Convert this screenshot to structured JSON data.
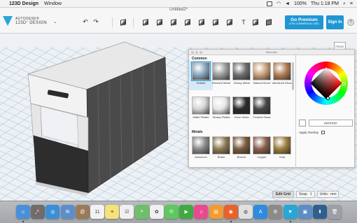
{
  "menubar": {
    "apple": "",
    "app_name": "123D Design",
    "menu_window": "Window",
    "battery": "100%",
    "clock": "Thu 1:18 PM"
  },
  "toolbar": {
    "doc_title": "Untitled2*",
    "logo_line1": "AUTODESK®",
    "logo_line2": "123D° DESIGN",
    "premium_title": "Go Premium",
    "premium_sub": "(FOR COMMERCIAL USE)",
    "sign_in": "Sign In",
    "help": "?",
    "text_tool": "T"
  },
  "viewcube": {
    "face": "FRONT"
  },
  "materials": {
    "title": "Materials",
    "common_label": "Common",
    "common": [
      {
        "name": "Default",
        "color": "#8aa6bc"
      },
      {
        "name": "Brushed Metal",
        "color": "#9a9a9a"
      },
      {
        "name": "Glossy Metal",
        "color": "#6e6e6e"
      },
      {
        "name": "Natural Wood",
        "color": "#c9a07a"
      },
      {
        "name": "Varnished Wood",
        "color": "#b27d55"
      },
      {
        "name": "Matte Plastic",
        "color": "#d4d4d4"
      },
      {
        "name": "Glossy Plastic",
        "color": "#e6e6e6"
      },
      {
        "name": "Clear Glass",
        "color": "#2a2a2a"
      },
      {
        "name": "Frosted Glass",
        "color": "#454545"
      }
    ],
    "metals_label": "Metals",
    "metals": [
      {
        "name": "Aluminum",
        "color": "#8a8a8a"
      },
      {
        "name": "Brass",
        "color": "#8d7a55"
      },
      {
        "name": "Bronze",
        "color": "#7a5a3c"
      },
      {
        "name": "Copper",
        "color": "#8a5f4d"
      },
      {
        "name": "Gold",
        "color": "#9a7d3c"
      }
    ],
    "hex_value": "#FFFFFF",
    "apply_overlay": "Apply Overlay"
  },
  "bottom_bar": {
    "edit_grid": "Edit Grid",
    "snap_label": "Snap",
    "snap_value": "1",
    "units": "Units : mm"
  },
  "dock": {
    "apps": [
      {
        "name": "finder",
        "color": "#4a90d9",
        "glyph": "☺"
      },
      {
        "name": "launchpad",
        "color": "#6d6d6d",
        "glyph": "🚀"
      },
      {
        "name": "safari",
        "color": "#3b8fd6",
        "glyph": "◎"
      },
      {
        "name": "mail",
        "color": "#5c8fc9",
        "glyph": "✉"
      },
      {
        "name": "contacts",
        "color": "#9b7a5a",
        "glyph": "@"
      },
      {
        "name": "calendar",
        "color": "#f2f2f2",
        "glyph": "11"
      },
      {
        "name": "notes",
        "color": "#f5e27a",
        "glyph": "≡"
      },
      {
        "name": "reminders",
        "color": "#f0f0f0",
        "glyph": "☑"
      },
      {
        "name": "maps",
        "color": "#6fbf6a",
        "glyph": "⌖"
      },
      {
        "name": "photos",
        "color": "#f0f0f0",
        "glyph": "✿"
      },
      {
        "name": "messages",
        "color": "#5fc75f",
        "glyph": "✆"
      },
      {
        "name": "facetime",
        "color": "#3faa3f",
        "glyph": "▶"
      },
      {
        "name": "itunes",
        "color": "#e94a8f",
        "glyph": "♫"
      },
      {
        "name": "ibooks",
        "color": "#f29b33",
        "glyph": "▤"
      },
      {
        "name": "firefox",
        "color": "#e8622c",
        "glyph": "◉"
      },
      {
        "name": "chrome",
        "color": "#e0e0e0",
        "glyph": "◍"
      },
      {
        "name": "app-store",
        "color": "#2e8be0",
        "glyph": "A"
      },
      {
        "name": "system-preferences",
        "color": "#8b8b8b",
        "glyph": "⚙"
      },
      {
        "name": "123d-design",
        "color": "#27a7d8",
        "glyph": "▼"
      },
      {
        "name": "preview",
        "color": "#5b8ec6",
        "glyph": "▣"
      },
      {
        "name": "downloads",
        "color": "#2f5f8f",
        "glyph": "⬇"
      },
      {
        "name": "trash",
        "color": "#9aa0a6",
        "glyph": "🗑"
      }
    ]
  }
}
